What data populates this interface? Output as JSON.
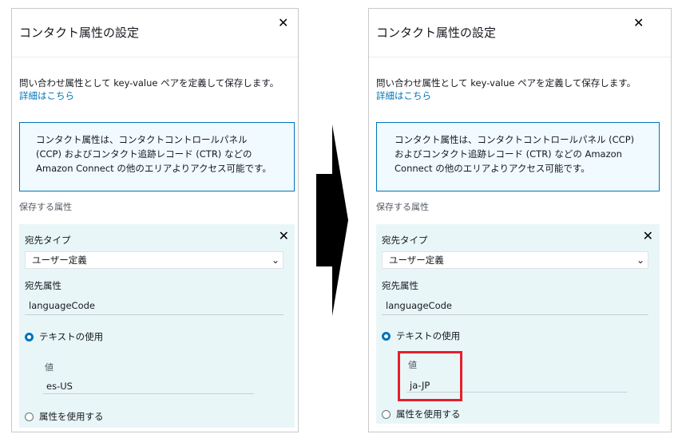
{
  "panel": {
    "title": "コンタクト属性の設定",
    "description": "問い合わせ属性として key-value ペアを定義して保存します。",
    "detail_link": "詳細はこちら",
    "info_left": [
      "コンタクト属性は、コンタクトコントロールパネル",
      "(CCP) およびコンタクト追跡レコード (CTR) などの",
      "Amazon Connect の他のエリアよりアクセス可能です。"
    ],
    "info_right": [
      "コンタクト属性は、コンタクトコントロールパネル (CCP)",
      "およびコンタクト追跡レコード (CTR) などの Amazon",
      "Connect の他のエリアよりアクセス可能です。"
    ],
    "store_label": "保存する属性",
    "dest_type_label": "宛先タイプ",
    "dest_type_value": "ユーザー定義",
    "dest_attr_label": "宛先属性",
    "dest_attr_value": "languageCode",
    "use_text_label": "テキストの使用",
    "value_label": "値",
    "use_attr_label": "属性を使用する"
  },
  "left": {
    "value": "es-US"
  },
  "right": {
    "value": "ja-JP"
  },
  "icons": {
    "close": "close-icon",
    "chevron": "chevron-down-icon",
    "arrow": "arrow-right-icon"
  },
  "colors": {
    "link": "#0073bb",
    "info_bg": "#f1faff",
    "attr_bg": "#e9f6f8",
    "highlight": "#e4202a"
  }
}
